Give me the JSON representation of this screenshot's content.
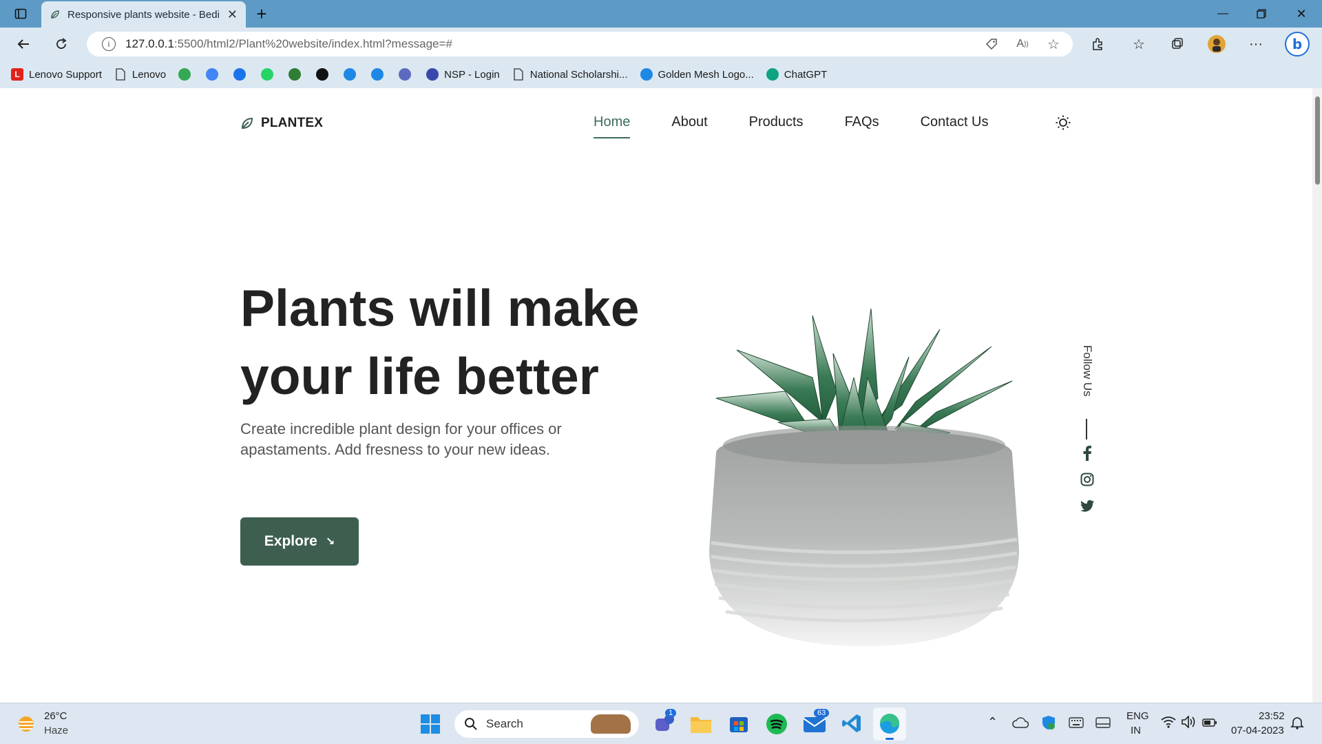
{
  "browser": {
    "tab_title": "Responsive plants website - Bedi",
    "url_host": "127.0.0.1",
    "url_rest": ":5500/html2/Plant%20website/index.html?message=#",
    "bookmarks": [
      {
        "label": "Lenovo Support",
        "icon": "lenovo-l-icon",
        "color": "#e2231a"
      },
      {
        "label": "Lenovo",
        "icon": "page-icon",
        "color": ""
      },
      {
        "label": "",
        "icon": "maps-icon",
        "color": "#34a853"
      },
      {
        "label": "",
        "icon": "translate-icon",
        "color": "#4285f4"
      },
      {
        "label": "",
        "icon": "forms-icon",
        "color": "#1a73e8"
      },
      {
        "label": "",
        "icon": "whatsapp-icon",
        "color": "#25d366"
      },
      {
        "label": "",
        "icon": "w-icon",
        "color": "#2e7d32"
      },
      {
        "label": "",
        "icon": "c-icon",
        "color": "#111"
      },
      {
        "label": "",
        "icon": "edge-icon",
        "color": "#1e88e5"
      },
      {
        "label": "",
        "icon": "search-icon",
        "color": "#1e88e5"
      },
      {
        "label": "",
        "icon": "wave-icon",
        "color": "#5c6bc0"
      },
      {
        "label": "NSP - Login",
        "icon": "nsp-icon",
        "color": "#3949ab"
      },
      {
        "label": "National Scholarshi...",
        "icon": "page-icon",
        "color": ""
      },
      {
        "label": "Golden Mesh Logo...",
        "icon": "play-icon",
        "color": "#1e88e5"
      },
      {
        "label": "ChatGPT",
        "icon": "chatgpt-icon",
        "color": "#10a37f"
      }
    ]
  },
  "site": {
    "brand": "PLANTEX",
    "nav": [
      {
        "label": "Home",
        "active": true
      },
      {
        "label": "About",
        "active": false
      },
      {
        "label": "Products",
        "active": false
      },
      {
        "label": "FAQs",
        "active": false
      },
      {
        "label": "Contact Us",
        "active": false
      }
    ],
    "hero": {
      "title_line1": "Plants will make",
      "title_line2": "your life better",
      "description": "Create incredible plant design for your offices or apastaments. Add fresness to your new ideas.",
      "cta": "Explore"
    },
    "follow_label": "Follow Us",
    "social_icons": [
      "facebook-icon",
      "instagram-icon",
      "twitter-icon"
    ],
    "accent_color": "#3e5f50"
  },
  "taskbar": {
    "weather_temp": "26°C",
    "weather_desc": "Haze",
    "search_placeholder": "Search",
    "teams_badge": "1",
    "mail_badge": "63",
    "lang": "ENG",
    "region": "IN",
    "time": "23:52",
    "date": "07-04-2023"
  }
}
